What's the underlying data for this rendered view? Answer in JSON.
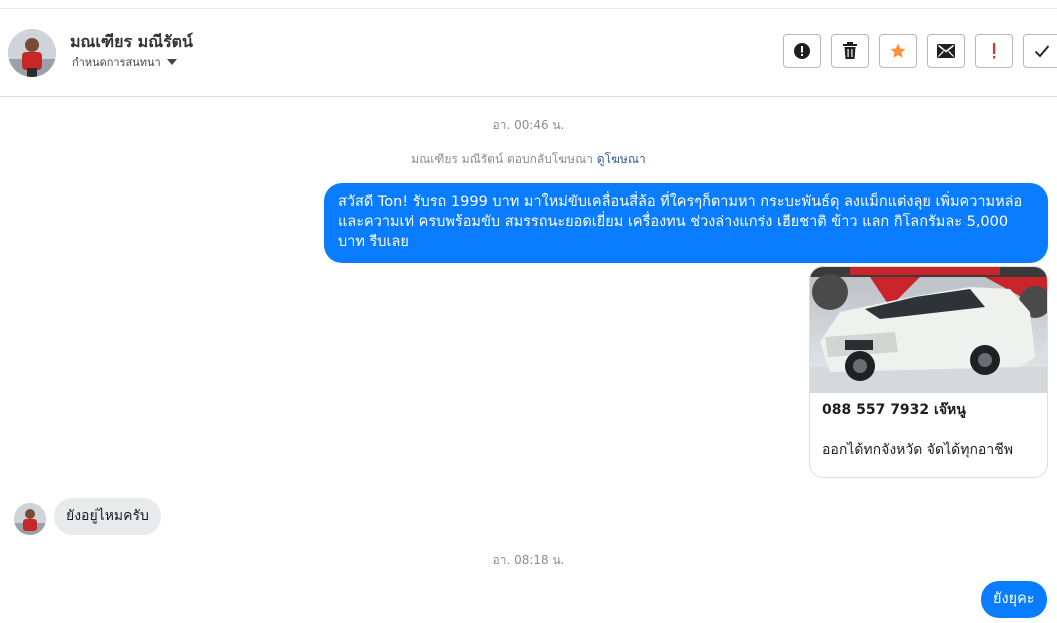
{
  "contact": {
    "name": "มณเฑียร มณีรัตน์",
    "conversation_menu": "กำหนดการสนทนา"
  },
  "toolbar": {
    "icons": [
      "alert-circle-icon",
      "trash-icon",
      "star-icon",
      "mail-icon",
      "exclamation-icon",
      "check-icon"
    ],
    "star_color": "#f7923b",
    "exclamation_color": "#e02d2d"
  },
  "messages": {
    "timestamp_1": "อา. 00:46 น.",
    "ad_reply_text": "มณเฑียร มณีรัตน์ ตอบกลับโฆษณา",
    "ad_reply_link": "ดูโฆษณา",
    "outgoing_1": "สวัสดี Ton! รับรถ 1999 บาท มาใหม่ขับเคลื่อนสี่ล้อ ที่ใครๆก็ตามหา กระบะพันธ์ดุ ลงแม็กแต่งลุย เพิ่มความหล่อและความเท่ ครบพร้อมขับ สมรรถนะยอดเยี่ยม เครื่องทน ช่วงล่างแกร่ง เฮียชาติ ข้าว แลก กิโลกรัมละ 5,000 บาท รีบเลย",
    "ad_card": {
      "title": "088 557 7932 เจ๊หนู",
      "description": "ออกได้ทกจังหวัด จัดได้ทุกอาชีพ"
    },
    "incoming_1": "ยังอยู่ไหมครับ",
    "timestamp_2": "อา. 08:18 น.",
    "outgoing_2": "ยังยุคะ"
  },
  "colors": {
    "outgoing_bubble": "#0a7cff",
    "incoming_bubble": "#e9eaec",
    "link": "#385898"
  }
}
